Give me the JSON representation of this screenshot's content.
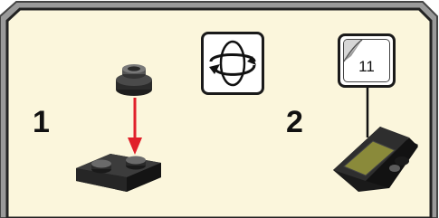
{
  "steps": [
    {
      "number": "1"
    },
    {
      "number": "2"
    }
  ],
  "rotate_icon": "rotate-model-icon",
  "sticker_callout": {
    "label": "11",
    "icon": "sticker-icon"
  },
  "colors": {
    "background": "#fbf6dc",
    "frame_border": "#8a8a8a",
    "arrow": "#e0202a",
    "brick": "#2a2a2a",
    "sticker": "#8a8a3a"
  }
}
